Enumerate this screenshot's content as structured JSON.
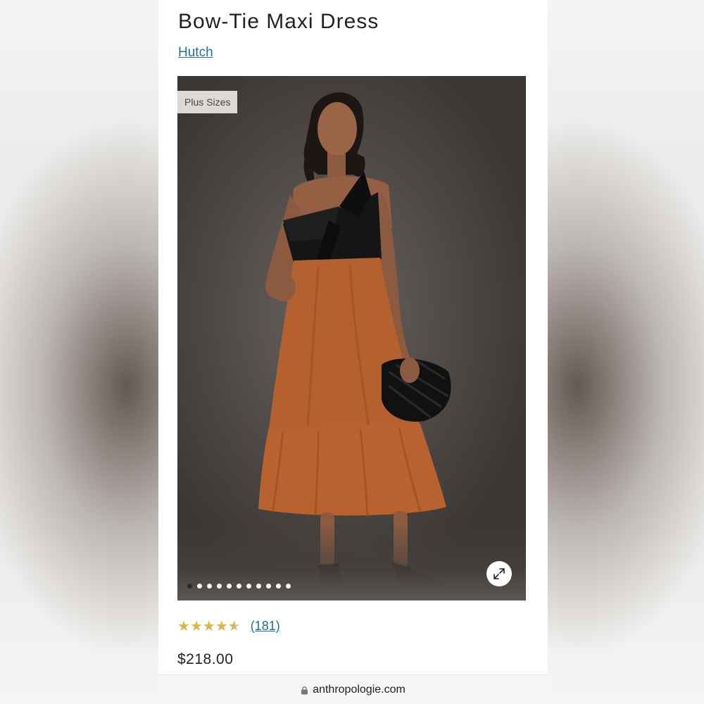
{
  "product": {
    "title": "Bow-Tie Maxi Dress",
    "brand": "Hutch",
    "badge": "Plus Sizes",
    "rating_value": 4.5,
    "rating_max": 5,
    "review_count": "(181)",
    "price": "$218.00"
  },
  "gallery": {
    "image_description_icon": "product-photo",
    "slide_count": 11,
    "active_slide": 1,
    "expand_icon": "expand-icon"
  },
  "browser": {
    "url": "anthropologie.com",
    "lock_icon": "lock-icon"
  },
  "colors": {
    "link": "#1e6fa0",
    "star": "#e0b53b",
    "dress_rust": "#b5602f",
    "bodice_black": "#151515"
  }
}
